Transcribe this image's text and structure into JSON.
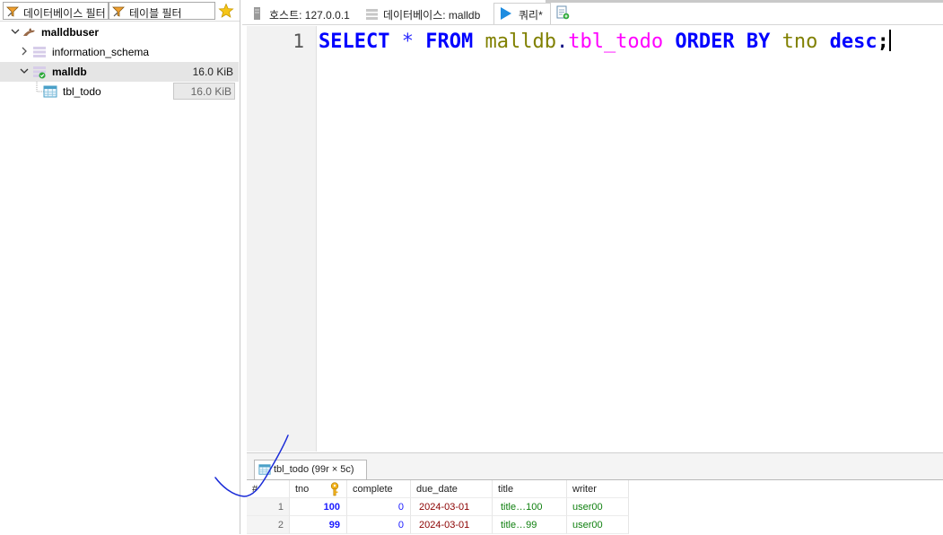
{
  "filters": {
    "db_filter_label": "데이터베이스 필터",
    "table_filter_label": "테이블 필터"
  },
  "tree": {
    "connection": "malldbuser",
    "schema1": "information_schema",
    "db": {
      "name": "malldb",
      "size": "16.0 KiB"
    },
    "table": {
      "name": "tbl_todo",
      "size": "16.0 KiB"
    }
  },
  "tabs": {
    "host": "호스트: 127.0.0.1",
    "database": "데이터베이스: malldb",
    "query": "쿼리*"
  },
  "editor": {
    "line_number": "1",
    "sql": {
      "select": "SELECT",
      "star": "*",
      "from": "FROM",
      "db": "malldb",
      "dot": ".",
      "table": "tbl_todo",
      "order_by": "ORDER BY",
      "column": "tno",
      "desc": "desc",
      "semicolon": ";"
    }
  },
  "results": {
    "tab_label": "tbl_todo (99r × 5c)",
    "columns": [
      "#",
      "tno",
      "complete",
      "due_date",
      "title",
      "writer"
    ],
    "rows": [
      {
        "n": "1",
        "tno": "100",
        "complete": "0",
        "due_date": "2024-03-01",
        "title": "title…100",
        "writer": "user00"
      },
      {
        "n": "2",
        "tno": "99",
        "complete": "0",
        "due_date": "2024-03-01",
        "title": "title…99",
        "writer": "user00"
      }
    ]
  },
  "colors": {
    "keyword": "#0000ff",
    "identifier": "#808000",
    "table_name": "#ff00ff",
    "date": "#8b0000",
    "text_value": "#108010",
    "annotation_stroke": "#1a2bd8"
  },
  "icons": [
    "filter-icon",
    "star-icon",
    "chevron-down-icon",
    "chevron-right-icon",
    "dolphin-icon",
    "database-icon",
    "table-icon",
    "server-icon",
    "play-icon",
    "new-query-icon",
    "primary-key-icon"
  ]
}
